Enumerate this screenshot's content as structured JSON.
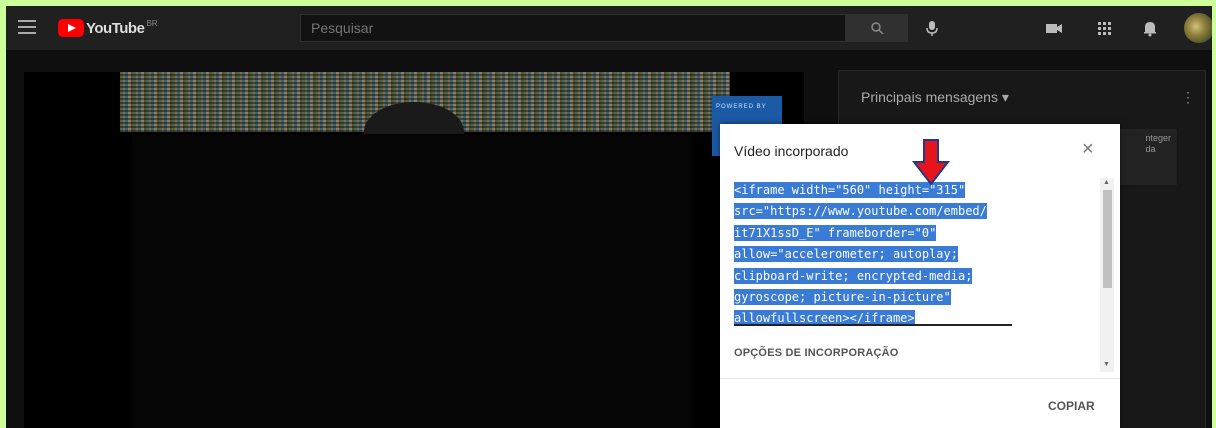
{
  "header": {
    "logo_text": "YouTube",
    "logo_country": "BR",
    "search_placeholder": "Pesquisar"
  },
  "chat": {
    "title": "Principais mensagens ▾",
    "card_text": "nteger\nda"
  },
  "video": {
    "powered_text": "POWERED BY"
  },
  "modal": {
    "title": "Vídeo incorporado",
    "close": "×",
    "code_lines": [
      "<iframe width=\"560\" height=\"315\"",
      "src=\"https://www.youtube.com/embed/",
      "it71X1ssD_E\" frameborder=\"0\"",
      "allow=\"accelerometer; autoplay;",
      "clipboard-write; encrypted-media;",
      "gyroscope; picture-in-picture\"",
      "allowfullscreen></iframe>"
    ],
    "options_label": "OPÇÕES DE INCORPORAÇÃO",
    "copy_label": "COPIAR"
  },
  "colors": {
    "background": "#ccff99",
    "selection": "#3a7bd5",
    "arrow": "#e8141c"
  }
}
